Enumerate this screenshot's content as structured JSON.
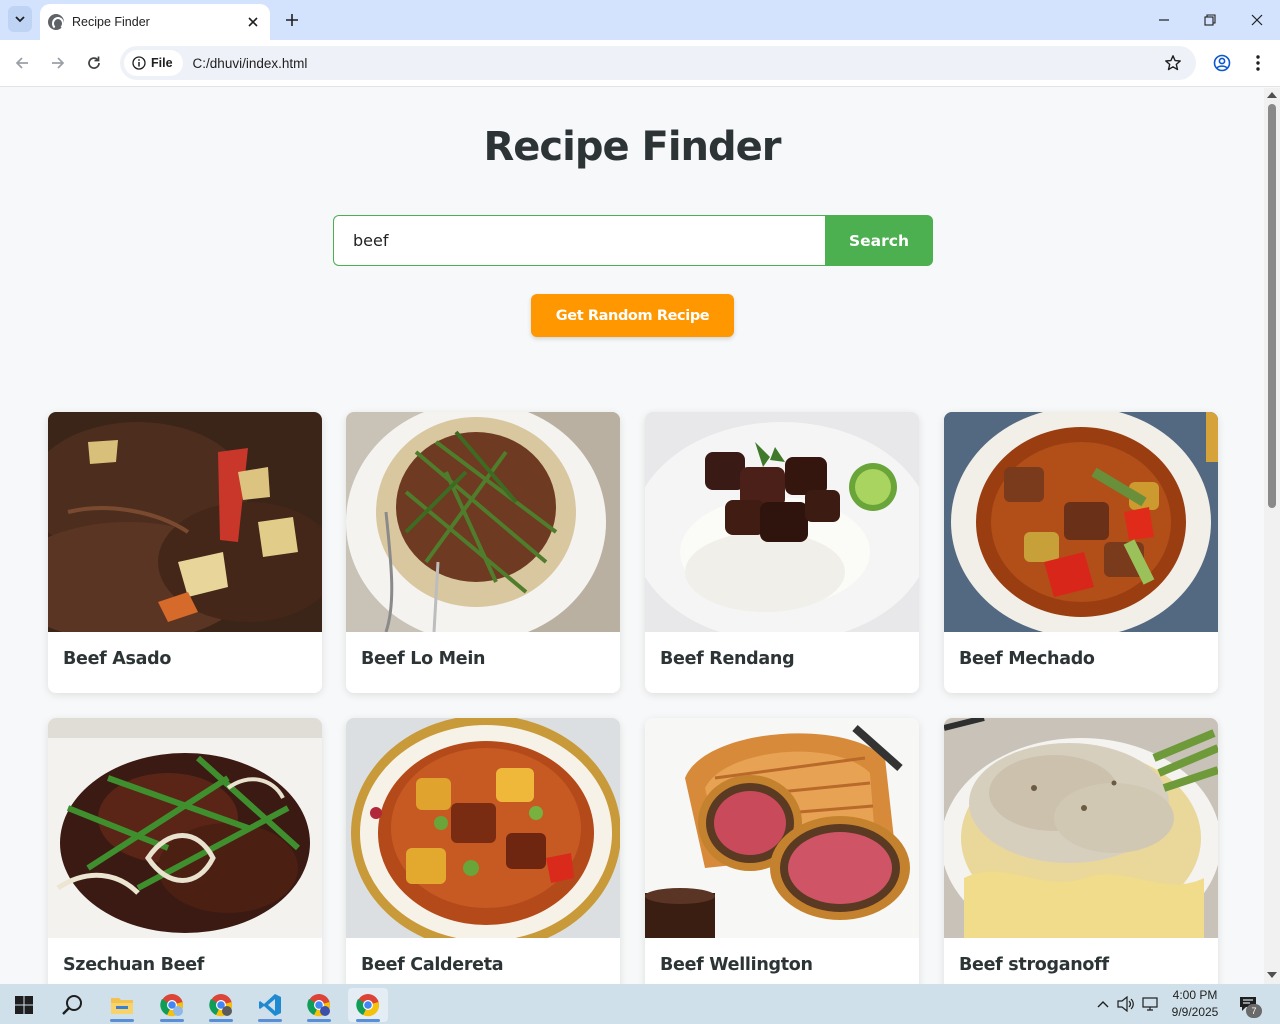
{
  "browser": {
    "tab_title": "Recipe Finder",
    "site_chip_label": "File",
    "url": "C:/dhuvi/index.html"
  },
  "page": {
    "title": "Recipe Finder",
    "search": {
      "value": "beef",
      "button_label": "Search"
    },
    "random_button_label": "Get Random Recipe",
    "recipes": [
      {
        "title": "Beef Asado"
      },
      {
        "title": "Beef Lo Mein"
      },
      {
        "title": "Beef Rendang"
      },
      {
        "title": "Beef Mechado"
      },
      {
        "title": "Szechuan Beef"
      },
      {
        "title": "Beef Caldereta"
      },
      {
        "title": "Beef Wellington"
      },
      {
        "title": "Beef stroganoff"
      }
    ]
  },
  "taskbar": {
    "time": "4:00 PM",
    "date": "9/9/2025",
    "notification_count": "7",
    "apps": [
      "start-icon",
      "search-icon",
      "file-explorer-icon",
      "chrome-icon",
      "chrome-icon",
      "vscode-icon",
      "chrome-icon",
      "chrome-icon"
    ]
  },
  "colors": {
    "accent_green": "#4caf50",
    "accent_orange": "#ff9800",
    "title_text": "#2d3436",
    "chrome_tabbar": "#d3e3fd"
  }
}
